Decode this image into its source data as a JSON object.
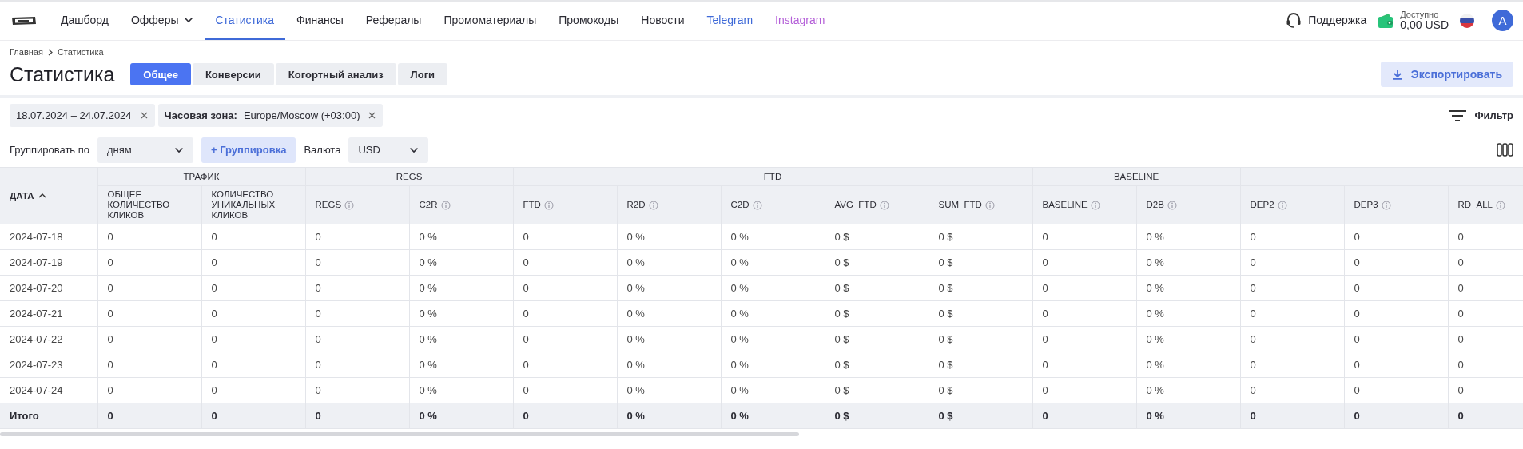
{
  "nav": {
    "items": [
      {
        "label": "Дашборд",
        "kind": "link",
        "selected": false,
        "color": "#2b2b33"
      },
      {
        "label": "Офферы",
        "kind": "dropdown",
        "selected": false,
        "color": "#2b2b33"
      },
      {
        "label": "Статистика",
        "kind": "link",
        "selected": true,
        "color": "#3f6ad8"
      },
      {
        "label": "Финансы",
        "kind": "link",
        "selected": false,
        "color": "#2b2b33"
      },
      {
        "label": "Рефералы",
        "kind": "link",
        "selected": false,
        "color": "#2b2b33"
      },
      {
        "label": "Промоматериалы",
        "kind": "link",
        "selected": false,
        "color": "#2b2b33"
      },
      {
        "label": "Промокоды",
        "kind": "link",
        "selected": false,
        "color": "#2b2b33"
      },
      {
        "label": "Новости",
        "kind": "link",
        "selected": false,
        "color": "#2b2b33"
      },
      {
        "label": "Telegram",
        "kind": "link",
        "selected": false,
        "color": "#3f6ad8"
      },
      {
        "label": "Instagram",
        "kind": "link",
        "selected": false,
        "color": "#b45fd8"
      }
    ],
    "support": "Поддержка",
    "balance_label": "Доступно",
    "balance": "0,00 USD",
    "avatar": "A"
  },
  "breadcrumb": [
    "Главная",
    "Статистика"
  ],
  "title": "Статистика",
  "tabs": [
    {
      "label": "Общее",
      "selected": true
    },
    {
      "label": "Конверсии",
      "selected": false
    },
    {
      "label": "Когортный анализ",
      "selected": false
    },
    {
      "label": "Логи",
      "selected": false
    }
  ],
  "export_button": "Экспортировать",
  "filters": {
    "chips": [
      {
        "value": "18.07.2024 – 24.07.2024"
      },
      {
        "label": "Часовая зона:",
        "value": "Europe/Moscow (+03:00)"
      }
    ],
    "filter_button": "Фильтр"
  },
  "grouping": {
    "label": "Группировать по",
    "value": "дням",
    "add_button": "+ Группировка",
    "currency_label": "Валюта",
    "currency": "USD"
  },
  "table": {
    "date_column": "ДАТА",
    "column_groups": [
      {
        "label": "ТРАФИК",
        "columns": [
          {
            "label": "ОБЩЕЕ КОЛИЧЕСТВО КЛИКОВ",
            "info": false
          },
          {
            "label": "КОЛИЧЕСТВО УНИКАЛЬНЫХ КЛИКОВ",
            "info": false
          }
        ]
      },
      {
        "label": "REGS",
        "columns": [
          {
            "label": "REGS",
            "info": true
          },
          {
            "label": "C2R",
            "info": true
          }
        ]
      },
      {
        "label": "FTD",
        "columns": [
          {
            "label": "FTD",
            "info": true
          },
          {
            "label": "R2D",
            "info": true
          },
          {
            "label": "C2D",
            "info": true
          },
          {
            "label": "AVG_FTD",
            "info": true
          },
          {
            "label": "SUM_FTD",
            "info": true
          }
        ]
      },
      {
        "label": "BASELINE",
        "columns": [
          {
            "label": "BASELINE",
            "info": true
          },
          {
            "label": "D2B",
            "info": true
          }
        ]
      },
      {
        "columns": [
          {
            "label": "DEP2",
            "info": true
          },
          {
            "label": "DEP3",
            "info": true
          },
          {
            "label": "RD_ALL",
            "info": true
          }
        ]
      }
    ],
    "rows": [
      {
        "date": "2024-07-18",
        "cells": [
          "0",
          "0",
          "0",
          "0 %",
          "0",
          "0 %",
          "0 %",
          "0 $",
          "0 $",
          "0",
          "0 %",
          "0",
          "0",
          "0"
        ]
      },
      {
        "date": "2024-07-19",
        "cells": [
          "0",
          "0",
          "0",
          "0 %",
          "0",
          "0 %",
          "0 %",
          "0 $",
          "0 $",
          "0",
          "0 %",
          "0",
          "0",
          "0"
        ]
      },
      {
        "date": "2024-07-20",
        "cells": [
          "0",
          "0",
          "0",
          "0 %",
          "0",
          "0 %",
          "0 %",
          "0 $",
          "0 $",
          "0",
          "0 %",
          "0",
          "0",
          "0"
        ]
      },
      {
        "date": "2024-07-21",
        "cells": [
          "0",
          "0",
          "0",
          "0 %",
          "0",
          "0 %",
          "0 %",
          "0 $",
          "0 $",
          "0",
          "0 %",
          "0",
          "0",
          "0"
        ]
      },
      {
        "date": "2024-07-22",
        "cells": [
          "0",
          "0",
          "0",
          "0 %",
          "0",
          "0 %",
          "0 %",
          "0 $",
          "0 $",
          "0",
          "0 %",
          "0",
          "0",
          "0"
        ]
      },
      {
        "date": "2024-07-23",
        "cells": [
          "0",
          "0",
          "0",
          "0 %",
          "0",
          "0 %",
          "0 %",
          "0 $",
          "0 $",
          "0",
          "0 %",
          "0",
          "0",
          "0"
        ]
      },
      {
        "date": "2024-07-24",
        "cells": [
          "0",
          "0",
          "0",
          "0 %",
          "0",
          "0 %",
          "0 %",
          "0 $",
          "0 $",
          "0",
          "0 %",
          "0",
          "0",
          "0"
        ]
      }
    ],
    "total": {
      "date": "Итого",
      "cells": [
        "0",
        "0",
        "0",
        "0 %",
        "0",
        "0 %",
        "0 %",
        "0 $",
        "0 $",
        "0",
        "0 %",
        "0",
        "0",
        "0"
      ]
    }
  }
}
